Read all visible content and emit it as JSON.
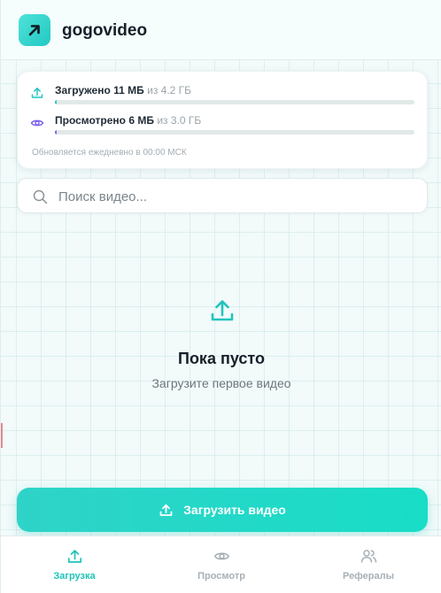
{
  "app": {
    "title": "gogovideo",
    "accent": "#22d3c5"
  },
  "quota": {
    "upload": {
      "label": "Загружено 11 МБ",
      "limit": "из 4.2 ГБ",
      "used_fraction": 0.0026,
      "color": "#22c4bd",
      "icon": "upload-icon"
    },
    "view": {
      "label": "Просмотрено 6 МБ",
      "limit": "из 3.0 ГБ",
      "used_fraction": 0.002,
      "color": "#7b5cf0",
      "icon": "eye-icon"
    },
    "note": "Обновляется ежедневно в 00:00 МСК"
  },
  "search": {
    "placeholder": "Поиск видео...",
    "value": ""
  },
  "empty_state": {
    "title": "Пока пусто",
    "subtitle": "Загрузите первое видео",
    "icon": "upload-icon"
  },
  "upload_button": {
    "label": "Загрузить видео",
    "icon": "upload-icon"
  },
  "nav": {
    "items": [
      {
        "label": "Загрузка",
        "icon": "upload-icon",
        "active": true
      },
      {
        "label": "Просмотр",
        "icon": "eye-icon",
        "active": false
      },
      {
        "label": "Рефералы",
        "icon": "users-icon",
        "active": false
      }
    ]
  }
}
